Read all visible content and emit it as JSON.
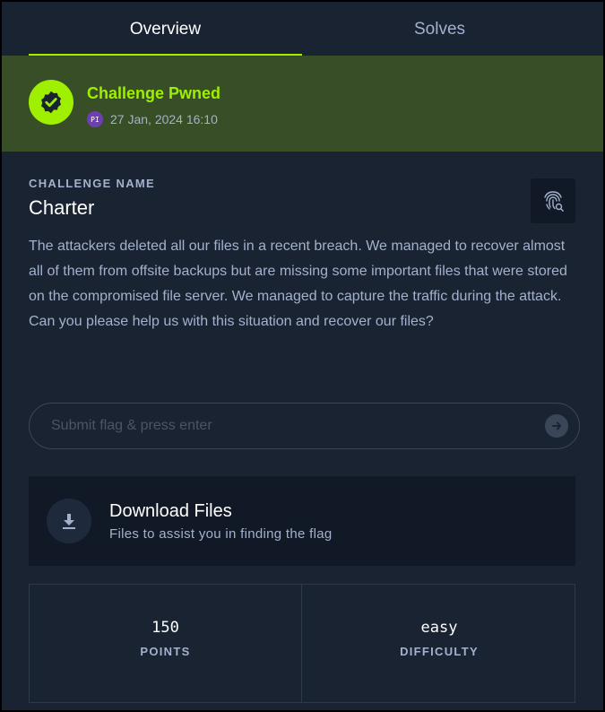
{
  "tabs": [
    {
      "label": "Overview",
      "active": true
    },
    {
      "label": "Solves",
      "active": false
    }
  ],
  "status": {
    "title": "Challenge Pwned",
    "avatar_initials": "PI",
    "date": "27 Jan, 2024 16:10"
  },
  "challenge": {
    "name_label": "CHALLENGE NAME",
    "name": "Charter",
    "description": "The attackers deleted all our files in a recent breach. We managed to recover almost all of them from offsite backups but are missing some important files that were stored on the compromised file server. We managed to capture the traffic during the attack. Can you please help us with this situation and recover our files?"
  },
  "flag": {
    "placeholder": "Submit flag & press enter",
    "value": ""
  },
  "download": {
    "title": "Download Files",
    "subtitle": "Files to assist you in finding the flag"
  },
  "stats": {
    "points_value": "150",
    "points_label": "POINTS",
    "difficulty_value": "easy",
    "difficulty_label": "DIFFICULTY"
  },
  "colors": {
    "accent": "#9fef00",
    "background": "#1a2332",
    "pwned_banner": "#374e26",
    "panel": "#111927",
    "muted_text": "#a4b1cd"
  },
  "icons": {
    "pwned": "verified-check-badge-icon",
    "fingerprint": "fingerprint-search-icon",
    "submit": "arrow-right-circle-icon",
    "download": "download-icon"
  }
}
